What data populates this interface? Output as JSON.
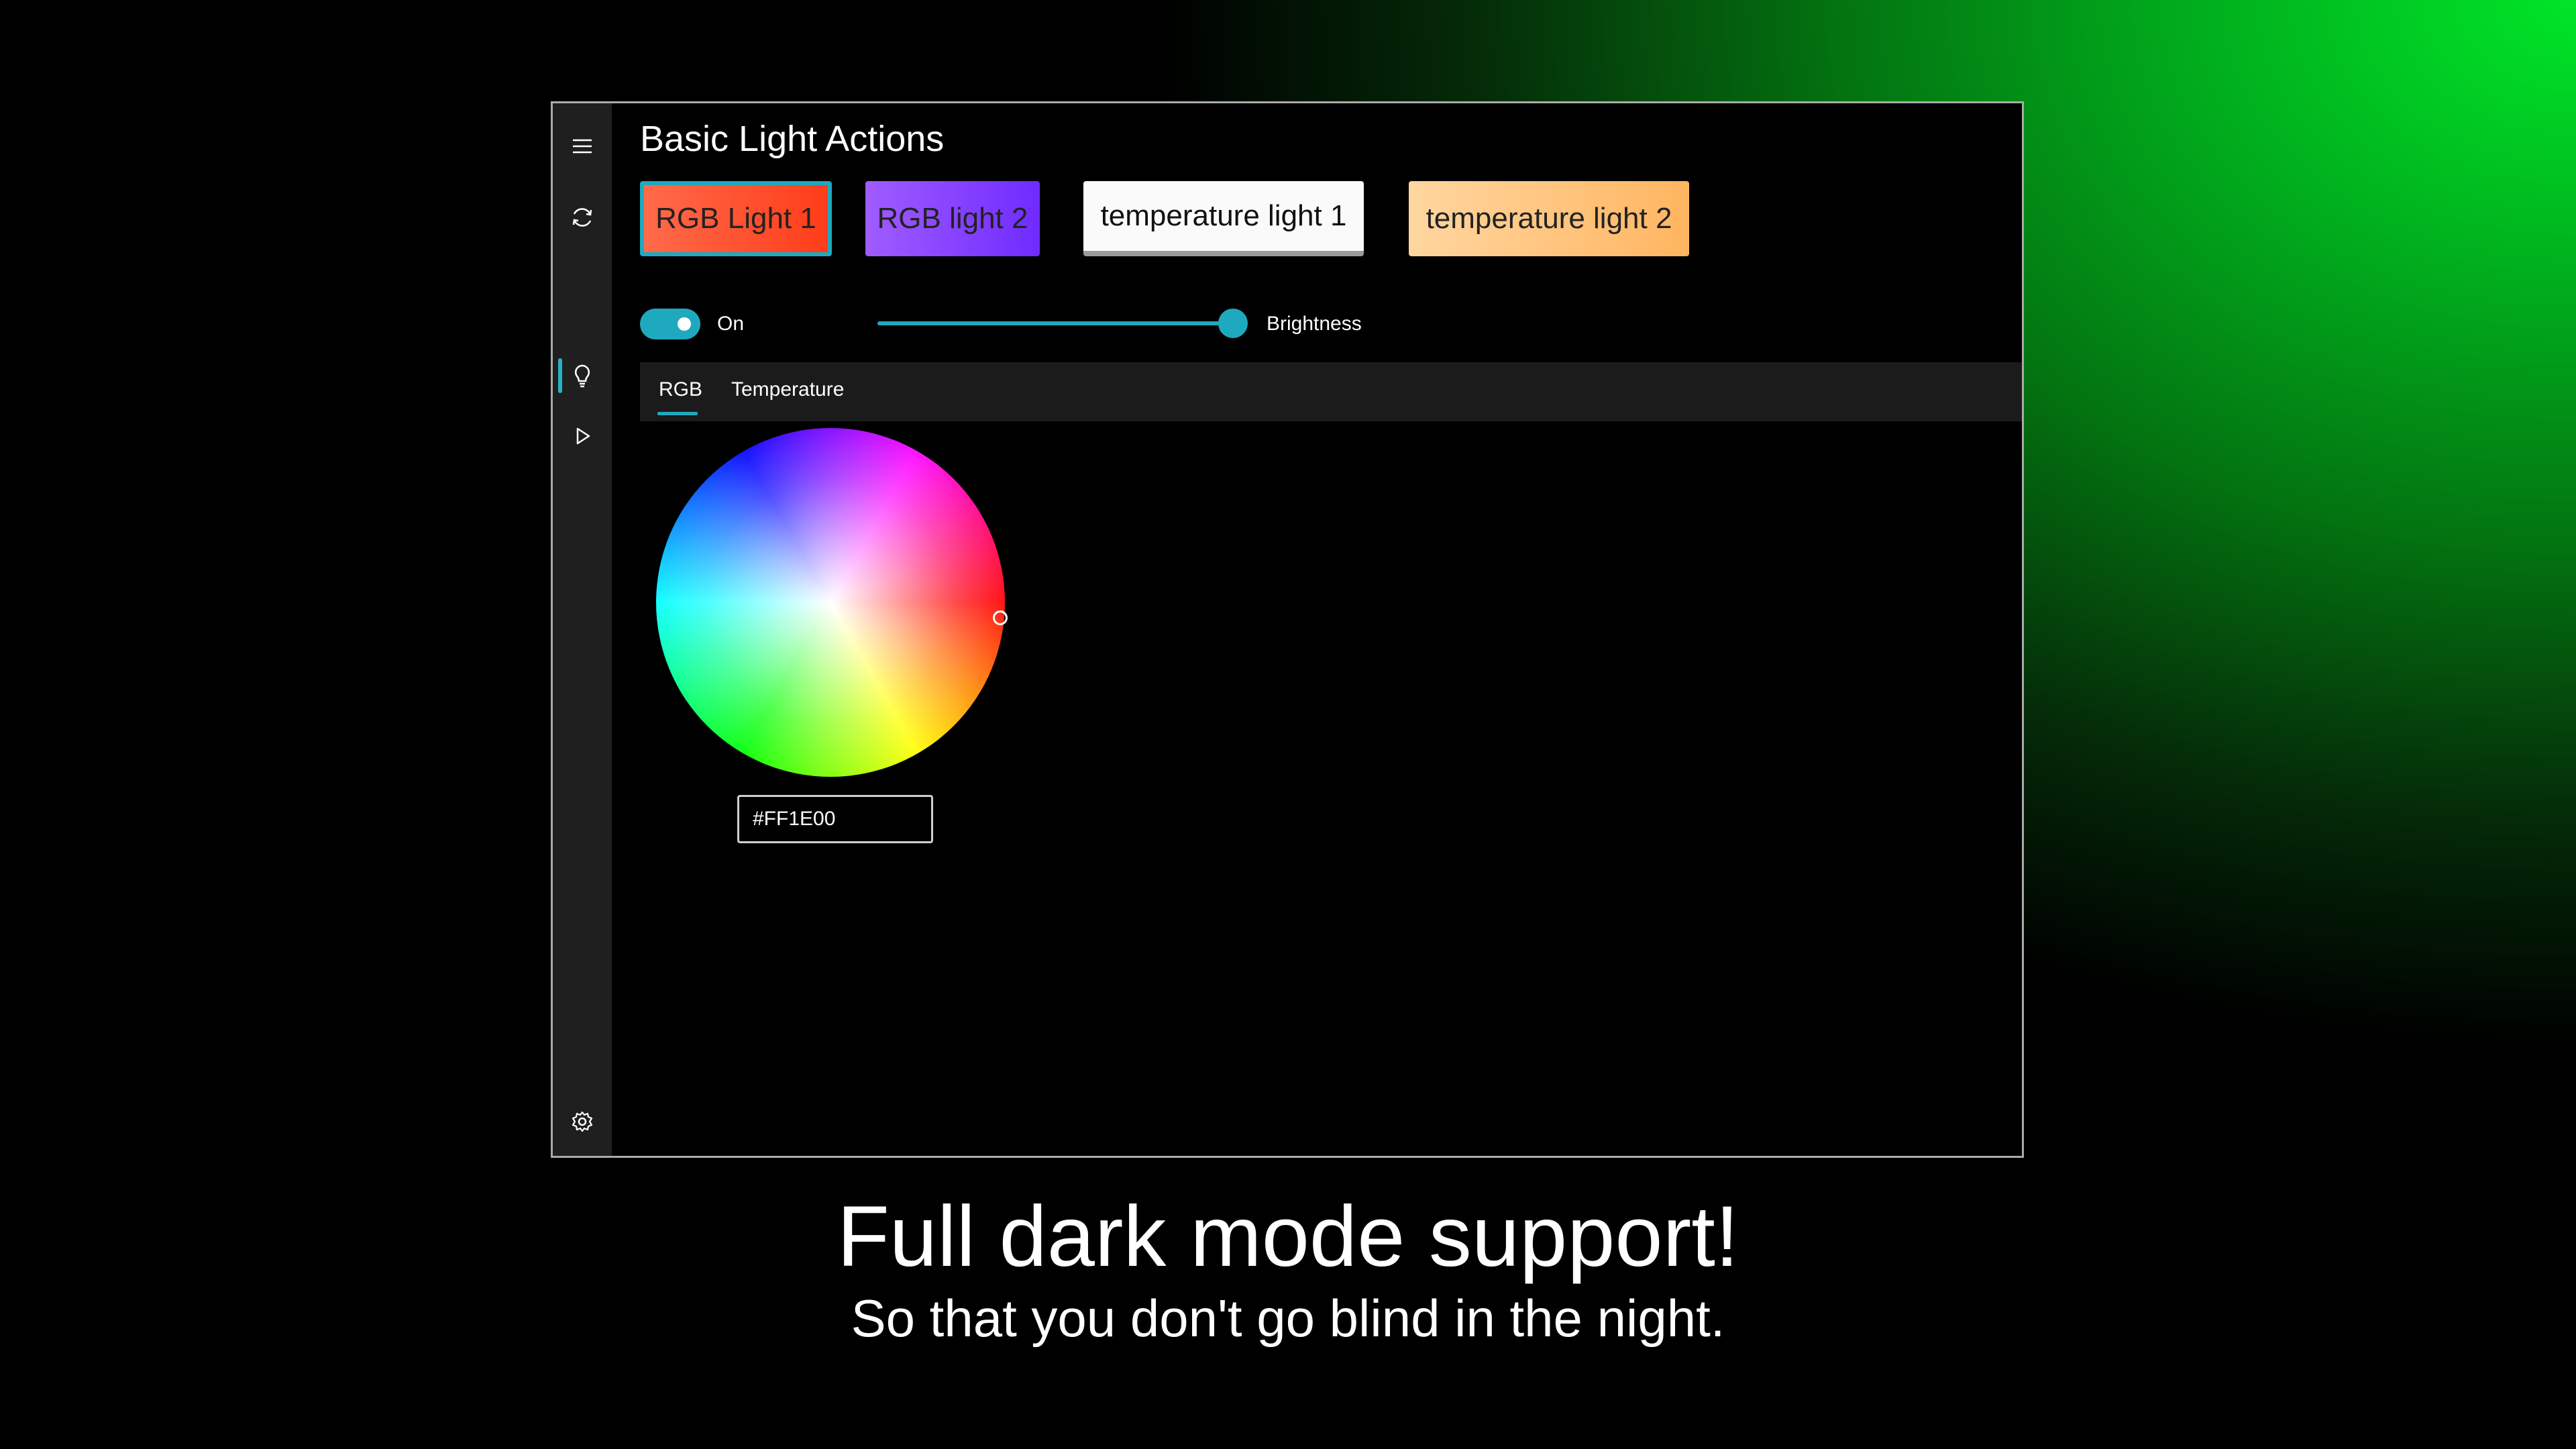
{
  "app": {
    "page_title": "Basic Light Actions"
  },
  "nav": {
    "items": [
      {
        "icon": "hamburger-menu-icon"
      },
      {
        "icon": "refresh-icon"
      },
      {
        "icon": "lightbulb-icon",
        "selected": true
      },
      {
        "icon": "play-icon"
      },
      {
        "icon": "gear-icon"
      }
    ]
  },
  "lights": [
    {
      "label": "RGB Light 1",
      "color": "#ff4a28",
      "selected": true
    },
    {
      "label": "RGB light 2",
      "color": "#8040ff"
    },
    {
      "label": "temperature light 1",
      "color": "#fafafa"
    },
    {
      "label": "temperature light 2",
      "color": "#ffc27a"
    }
  ],
  "controls": {
    "toggle_label": "On",
    "toggle_on": true,
    "brightness_label": "Brightness",
    "brightness_value": 1.0
  },
  "tabs": [
    {
      "label": "RGB",
      "selected": true
    },
    {
      "label": "Temperature"
    }
  ],
  "color_picker": {
    "hex_value": "#FF1E00"
  },
  "caption": {
    "title": "Full dark mode support!",
    "subtitle": "So that you don't go blind in the night."
  },
  "colors": {
    "accent": "#1fa9bf",
    "rail_bg": "#1f1f1f",
    "window_bg": "#000000"
  }
}
